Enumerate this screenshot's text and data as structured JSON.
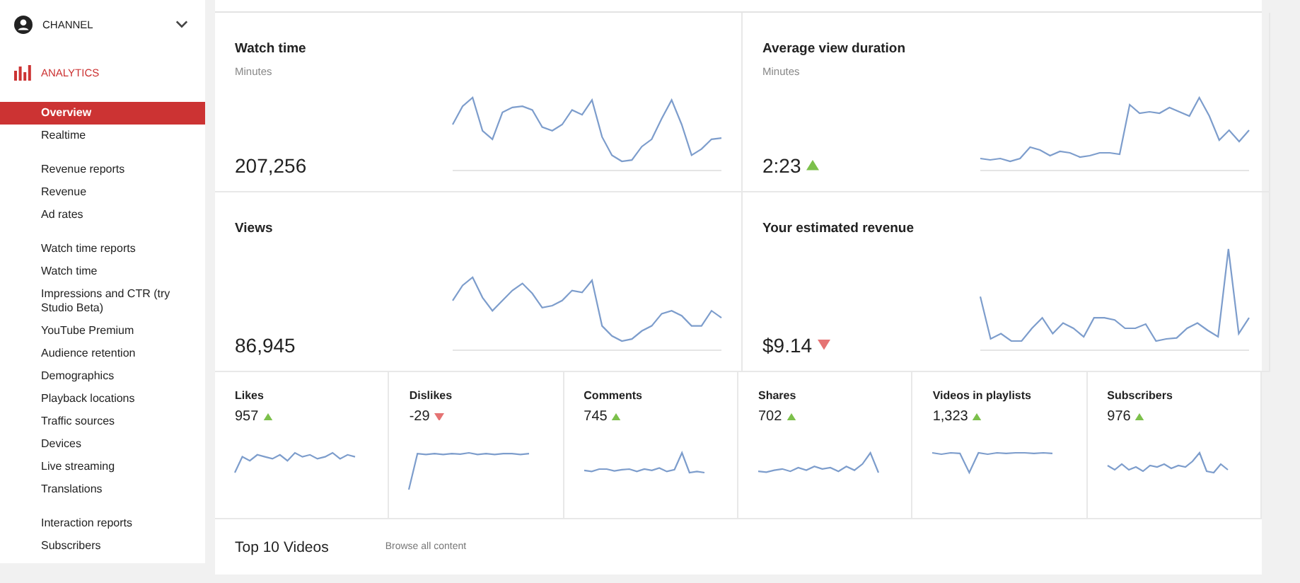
{
  "sidebar": {
    "channel": {
      "label": "CHANNEL",
      "expanded": false
    },
    "analytics": {
      "label": "ANALYTICS"
    },
    "groups": [
      {
        "items": [
          {
            "label": "Overview",
            "selected": true
          },
          {
            "label": "Realtime",
            "selected": false
          }
        ]
      },
      {
        "items": [
          {
            "label": "Revenue reports",
            "selected": false
          },
          {
            "label": "Revenue",
            "selected": false
          },
          {
            "label": "Ad rates",
            "selected": false
          }
        ]
      },
      {
        "items": [
          {
            "label": "Watch time reports",
            "selected": false
          },
          {
            "label": "Watch time",
            "selected": false
          },
          {
            "label": "Impressions and CTR (try Studio Beta)",
            "selected": false
          },
          {
            "label": "YouTube Premium",
            "selected": false
          },
          {
            "label": "Audience retention",
            "selected": false
          },
          {
            "label": "Demographics",
            "selected": false
          },
          {
            "label": "Playback locations",
            "selected": false
          },
          {
            "label": "Traffic sources",
            "selected": false
          },
          {
            "label": "Devices",
            "selected": false
          },
          {
            "label": "Live streaming",
            "selected": false
          },
          {
            "label": "Translations",
            "selected": false
          }
        ]
      },
      {
        "items": [
          {
            "label": "Interaction reports",
            "selected": false
          },
          {
            "label": "Subscribers",
            "selected": false
          }
        ]
      }
    ]
  },
  "big_cards": [
    {
      "title": "Watch time",
      "subtitle": "Minutes",
      "value": "207,256"
    },
    {
      "title": "Average view duration",
      "subtitle": "Minutes",
      "value": "2:23",
      "rising": true
    },
    {
      "title": "Views",
      "value": "86,945"
    },
    {
      "title": "Your estimated revenue",
      "value": "$9.14",
      "rising": false
    }
  ],
  "small_cards": [
    {
      "title": "Likes",
      "value": "957",
      "rising": true
    },
    {
      "title": "Dislikes",
      "value": "-29",
      "rising": false
    },
    {
      "title": "Comments",
      "value": "745",
      "rising": true
    },
    {
      "title": "Shares",
      "value": "702",
      "rising": true
    },
    {
      "title": "Videos in playlists",
      "value": "1,323",
      "rising": true
    },
    {
      "title": "Subscribers",
      "value": "976",
      "rising": true
    }
  ],
  "top_videos": {
    "title": "Top 10 Videos",
    "link": "Browse all content"
  }
}
